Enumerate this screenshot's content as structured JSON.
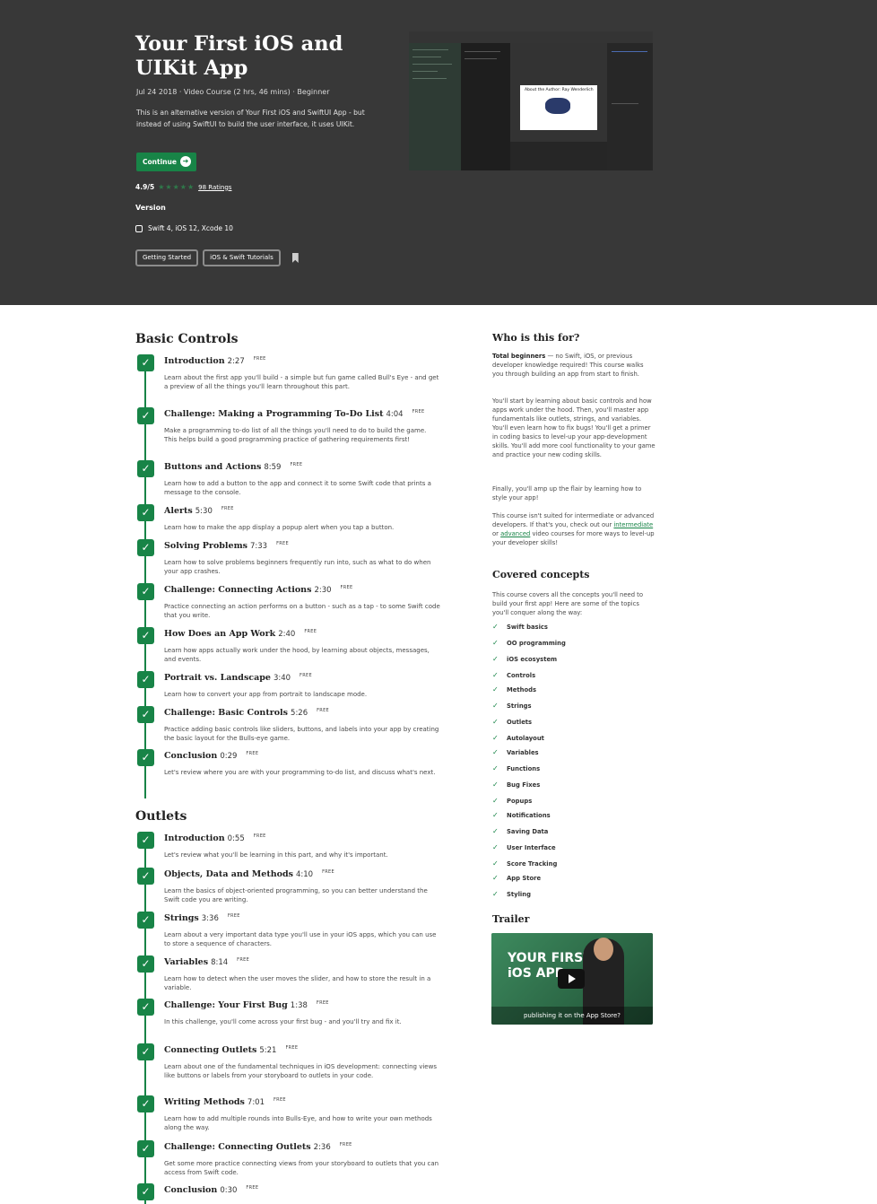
{
  "hero": {
    "title": "Your First iOS and UIKit App",
    "meta": "Jul 24 2018 · Video Course (2 hrs, 46 mins) · Beginner",
    "description": "This is an alternative version of Your First iOS and SwiftUI App - but instead of using SwiftUI to build the user interface, it uses UIKit.",
    "continue_label": "Continue",
    "rating": "4.9/5",
    "ratings_link": "98 Ratings",
    "version_label": "Version",
    "version_value": "Swift 4, iOS 12, Xcode 10",
    "tags": [
      "Getting Started",
      "iOS & Swift Tutorials"
    ],
    "screenshot_caption": "About the Author: Ray Wenderlich"
  },
  "free_label": "FREE",
  "sections": [
    {
      "title": "Basic Controls",
      "lessons": [
        {
          "title": "Introduction",
          "duration": "2:27",
          "desc": "Learn about the first app you'll build - a simple but fun game called Bull's Eye - and get a preview of all the things you'll learn throughout this part."
        },
        {
          "title": "Challenge: Making a Programming To-Do List",
          "duration": "4:04",
          "desc": "Make a programming to-do list of all the things you'll need to do to build the game. This helps build a good programming practice of gathering requirements first!"
        },
        {
          "title": "Buttons and Actions",
          "duration": "8:59",
          "desc": "Learn how to add a button to the app and connect it to some Swift code that prints a message to the console."
        },
        {
          "title": "Alerts",
          "duration": "5:30",
          "desc": "Learn how to make the app display a popup alert when you tap a button."
        },
        {
          "title": "Solving Problems",
          "duration": "7:33",
          "desc": "Learn how to solve problems beginners frequently run into, such as what to do when your app crashes."
        },
        {
          "title": "Challenge: Connecting Actions",
          "duration": "2:30",
          "desc": "Practice connecting an action performs on a button - such as a tap - to some Swift code that you write."
        },
        {
          "title": "How Does an App Work",
          "duration": "2:40",
          "desc": "Learn how apps actually work under the hood, by learning about objects, messages, and events."
        },
        {
          "title": "Portrait vs. Landscape",
          "duration": "3:40",
          "desc": "Learn how to convert your app from portrait to landscape mode."
        },
        {
          "title": "Challenge: Basic Controls",
          "duration": "5:26",
          "desc": "Practice adding basic controls like sliders, buttons, and labels into your app by creating the basic layout for the Bulls-eye game."
        },
        {
          "title": "Conclusion",
          "duration": "0:29",
          "desc": "Let's review where you are with your programming to-do list, and discuss what's next."
        }
      ]
    },
    {
      "title": "Outlets",
      "lessons": [
        {
          "title": "Introduction",
          "duration": "0:55",
          "desc": "Let's review what you'll be learning in this part, and why it's important."
        },
        {
          "title": "Objects, Data and Methods",
          "duration": "4:10",
          "desc": "Learn the basics of object-oriented programming, so you can better understand the Swift code you are writing."
        },
        {
          "title": "Strings",
          "duration": "3:36",
          "desc": "Learn about a very important data type you'll use in your iOS apps, which you can use to store a sequence of characters."
        },
        {
          "title": "Variables",
          "duration": "8:14",
          "desc": "Learn how to detect when the user moves the slider, and how to store the result in a variable."
        },
        {
          "title": "Challenge: Your First Bug",
          "duration": "1:38",
          "desc": "In this challenge, you'll come across your first bug - and you'll try and fix it."
        },
        {
          "title": "Connecting Outlets",
          "duration": "5:21",
          "desc": "Learn about one of the fundamental techniques in iOS development: connecting views like buttons or labels from your storyboard to outlets in your code."
        },
        {
          "title": "Writing Methods",
          "duration": "7:01",
          "desc": "Learn how to add multiple rounds into Bulls-Eye, and how to write your own methods along the way."
        },
        {
          "title": "Challenge: Connecting Outlets",
          "duration": "2:36",
          "desc": "Get some more practice connecting views from your storyboard to outlets that you can access from Swift code."
        },
        {
          "title": "Conclusion",
          "duration": "0:30",
          "desc": ""
        }
      ]
    }
  ],
  "sidebar": {
    "who_title": "Who is this for?",
    "who_bold": "Total beginners",
    "who_p1": " — no Swift, iOS, or previous developer knowledge required! This course walks you through building an app from start to finish.",
    "who_p2": "You'll start by learning about basic controls and how apps work under the hood. Then, you'll master app fundamentals like outlets, strings, and variables. You'll even learn how to fix bugs! You'll get a primer in coding basics to level-up your app-development skills. You'll add more cool functionality to your game and practice your new coding skills.",
    "who_p3": "Finally, you'll amp up the flair by learning how to style your app!",
    "who_p4_a": "This course isn't suited for intermediate or advanced developers. If that's you, check out our ",
    "link_intermediate": "intermediate",
    "who_p4_or": " or ",
    "link_advanced": "advanced",
    "who_p4_b": " video courses for more ways to level-up your developer skills!",
    "concepts_title": "Covered concepts",
    "concepts_intro": "This course covers all the concepts you'll need to build your first app! Here are some of the topics you'll conquer along the way:",
    "concepts": [
      "Swift basics",
      "OO programming",
      "iOS ecosystem",
      "Controls",
      "Methods",
      "Strings",
      "Outlets",
      "Autolayout",
      "Variables",
      "Functions",
      "Bug Fixes",
      "Popups",
      "Notifications",
      "Saving Data",
      "User Interface",
      "Score Tracking",
      "App Store",
      "Styling"
    ],
    "trailer_title": "Trailer",
    "trailer_overlay": "YOUR FIRST iOS APP",
    "trailer_caption": "publishing it on the App Store?"
  }
}
